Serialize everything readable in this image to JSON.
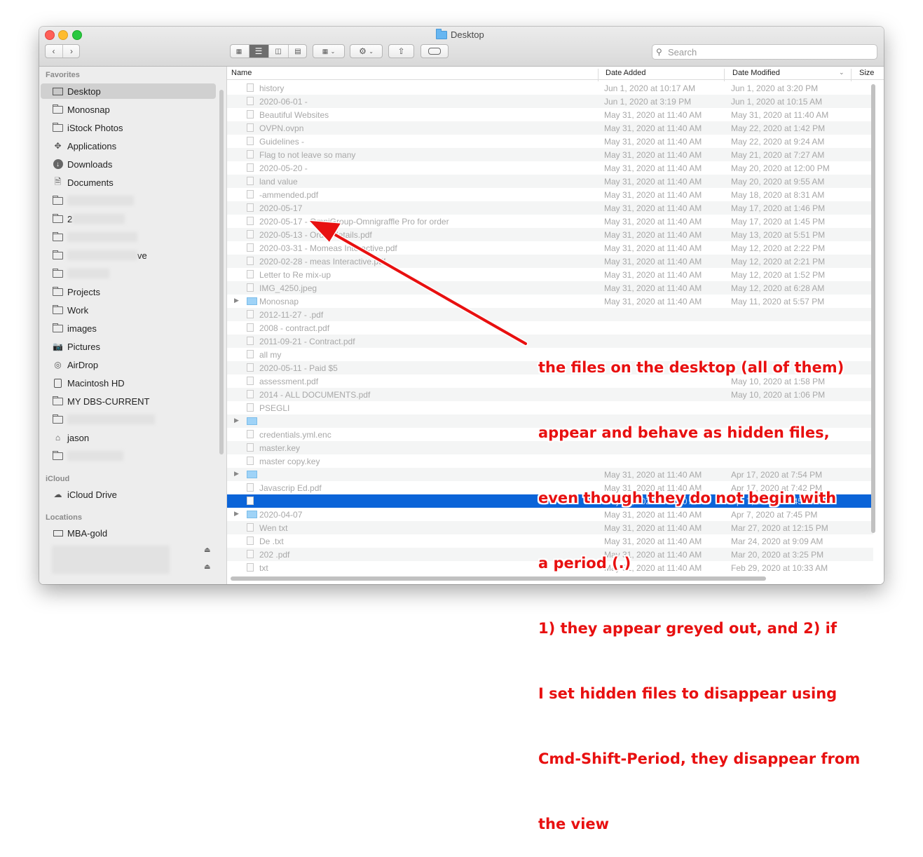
{
  "window": {
    "title": "Desktop"
  },
  "toolbar": {
    "back_icon": "chevron-left-icon",
    "forward_icon": "chevron-right-icon",
    "view_modes": [
      "icon-view",
      "list-view",
      "column-view",
      "gallery-view"
    ],
    "active_view": "list-view",
    "search_placeholder": "Search"
  },
  "sidebar": {
    "favorites_label": "Favorites",
    "icloud_label": "iCloud",
    "locations_label": "Locations",
    "favorites": [
      {
        "label": "Desktop",
        "icon": "desktop-icon",
        "selected": true
      },
      {
        "label": "Monosnap",
        "icon": "folder-icon"
      },
      {
        "label": "iStock Photos",
        "icon": "folder-icon"
      },
      {
        "label": "Applications",
        "icon": "applications-icon"
      },
      {
        "label": "Downloads",
        "icon": "downloads-icon"
      },
      {
        "label": "Documents",
        "icon": "documents-icon"
      },
      {
        "label": "",
        "icon": "folder-icon"
      },
      {
        "label": "2",
        "icon": "folder-icon"
      },
      {
        "label": "",
        "icon": "folder-icon"
      },
      {
        "label": "ve",
        "icon": "folder-icon"
      },
      {
        "label": "",
        "icon": "folder-icon"
      },
      {
        "label": "Projects",
        "icon": "folder-icon"
      },
      {
        "label": "Work",
        "icon": "folder-icon"
      },
      {
        "label": "images",
        "icon": "folder-icon"
      },
      {
        "label": "Pictures",
        "icon": "camera-icon"
      },
      {
        "label": "AirDrop",
        "icon": "airdrop-icon"
      },
      {
        "label": "Macintosh HD",
        "icon": "disk-icon"
      },
      {
        "label": "MY DBS-CURRENT",
        "icon": "folder-icon"
      },
      {
        "label": "",
        "icon": "folder-icon"
      },
      {
        "label": "jason",
        "icon": "home-icon"
      },
      {
        "label": "",
        "icon": "folder-icon"
      }
    ],
    "icloud": [
      {
        "label": "iCloud Drive",
        "icon": "cloud-icon"
      }
    ],
    "locations": [
      {
        "label": "MBA-gold",
        "icon": "laptop-icon"
      }
    ]
  },
  "columns": {
    "name": "Name",
    "date_added": "Date Added",
    "date_modified": "Date Modified",
    "size": "Size"
  },
  "files": [
    {
      "name": "history",
      "added": "Jun 1, 2020 at 10:17 AM",
      "modified": "Jun 1, 2020 at 3:20 PM"
    },
    {
      "name": "2020-06-01 - ",
      "added": "Jun 1, 2020 at 3:19 PM",
      "modified": "Jun 1, 2020 at 10:15 AM"
    },
    {
      "name": "Beautiful Websites",
      "added": "May 31, 2020 at 11:40 AM",
      "modified": "May 31, 2020 at 11:40 AM"
    },
    {
      "name": "OVPN.ovpn",
      "added": "May 31, 2020 at 11:40 AM",
      "modified": "May 22, 2020 at 1:42 PM"
    },
    {
      "name": "Guidelines -",
      "added": "May 31, 2020 at 11:40 AM",
      "modified": "May 22, 2020 at 9:24 AM"
    },
    {
      "name": "Flag to not leave so many",
      "added": "May 31, 2020 at 11:40 AM",
      "modified": "May 21, 2020 at 7:27 AM"
    },
    {
      "name": "2020-05-20 -",
      "added": "May 31, 2020 at 11:40 AM",
      "modified": "May 20, 2020 at 12:00 PM"
    },
    {
      "name": "land value",
      "added": "May 31, 2020 at 11:40 AM",
      "modified": "May 20, 2020 at 9:55 AM"
    },
    {
      "name": "-ammended.pdf",
      "added": "May 31, 2020 at 11:40 AM",
      "modified": "May 18, 2020 at 8:31 AM"
    },
    {
      "name": "2020-05-17",
      "added": "May 31, 2020 at 11:40 AM",
      "modified": "May 17, 2020 at 1:46 PM"
    },
    {
      "name": "2020-05-17 - OmniGroup-Omnigraffle Pro for order",
      "added": "May 31, 2020 at 11:40 AM",
      "modified": "May 17, 2020 at 1:45 PM"
    },
    {
      "name": "2020-05-13 - Order details.pdf",
      "added": "May 31, 2020 at 11:40 AM",
      "modified": "May 13, 2020 at 5:51 PM"
    },
    {
      "name": "2020-03-31 - Momeas Interactive.pdf",
      "added": "May 31, 2020 at 11:40 AM",
      "modified": "May 12, 2020 at 2:22 PM"
    },
    {
      "name": "2020-02-28 - meas Interactive.pdf",
      "added": "May 31, 2020 at 11:40 AM",
      "modified": "May 12, 2020 at 2:21 PM"
    },
    {
      "name": "Letter to Re mix-up",
      "added": "May 31, 2020 at 11:40 AM",
      "modified": "May 12, 2020 at 1:52 PM"
    },
    {
      "name": "IMG_4250.jpeg",
      "added": "May 31, 2020 at 11:40 AM",
      "modified": "May 12, 2020 at 6:28 AM"
    },
    {
      "name": "Monosnap",
      "added": "May 31, 2020 at 11:40 AM",
      "modified": "May 11, 2020 at 5:57 PM",
      "folder": true
    },
    {
      "name": "2012-11-27 - .pdf",
      "added": "",
      "modified": ""
    },
    {
      "name": "2008 - contract.pdf",
      "added": "",
      "modified": ""
    },
    {
      "name": "2011-09-21 - Contract.pdf",
      "added": "",
      "modified": ""
    },
    {
      "name": "all my",
      "added": "",
      "modified": ""
    },
    {
      "name": "2020-05-11 - Paid $5",
      "added": "",
      "modified": ""
    },
    {
      "name": "assessment.pdf",
      "added": "",
      "modified": "May 10, 2020 at 1:58 PM"
    },
    {
      "name": "2014 - ALL DOCUMENTS.pdf",
      "added": "",
      "modified": "May 10, 2020 at 1:06 PM"
    },
    {
      "name": "PSEGLI",
      "added": "",
      "modified": ""
    },
    {
      "name": "",
      "added": "",
      "modified": "",
      "folder": true
    },
    {
      "name": "credentials.yml.enc",
      "added": "",
      "modified": ""
    },
    {
      "name": "master.key",
      "added": "",
      "modified": ""
    },
    {
      "name": "master copy.key",
      "added": "",
      "modified": ""
    },
    {
      "name": "",
      "added": "May 31, 2020 at 11:40 AM",
      "modified": "Apr 17, 2020 at 7:54 PM",
      "folder": true
    },
    {
      "name": "Javascrip Ed.pdf",
      "added": "May 31, 2020 at 11:40 AM",
      "modified": "Apr 17, 2020 at 7:42 PM"
    },
    {
      "name": "",
      "added": "May 31, 2020 at 11:40 AM",
      "modified": "Apr 7, 2020 at 7:45 PM",
      "selected": true
    },
    {
      "name": "2020-04-07",
      "added": "May 31, 2020 at 11:40 AM",
      "modified": "Apr 7, 2020 at 7:45 PM",
      "folder": true
    },
    {
      "name": "Wen txt",
      "added": "May 31, 2020 at 11:40 AM",
      "modified": "Mar 27, 2020 at 12:15 PM"
    },
    {
      "name": "De .txt",
      "added": "May 31, 2020 at 11:40 AM",
      "modified": "Mar 24, 2020 at 9:09 AM"
    },
    {
      "name": "202 .pdf",
      "added": "May 31, 2020 at 11:40 AM",
      "modified": "Mar 20, 2020 at 3:25 PM"
    },
    {
      "name": "txt",
      "added": "May 31, 2020 at 11:40 AM",
      "modified": "Feb 29, 2020 at 10:33 AM"
    }
  ],
  "annotation": {
    "lines": [
      "the files on the desktop (all of them)",
      "appear and behave as hidden files,",
      "even though they do not begin with",
      "a period (.)",
      "1) they appear greyed out, and 2) if",
      "I set hidden files to disappear using",
      "Cmd-Shift-Period, they disappear from",
      "the view"
    ],
    "color": "#e81010"
  }
}
